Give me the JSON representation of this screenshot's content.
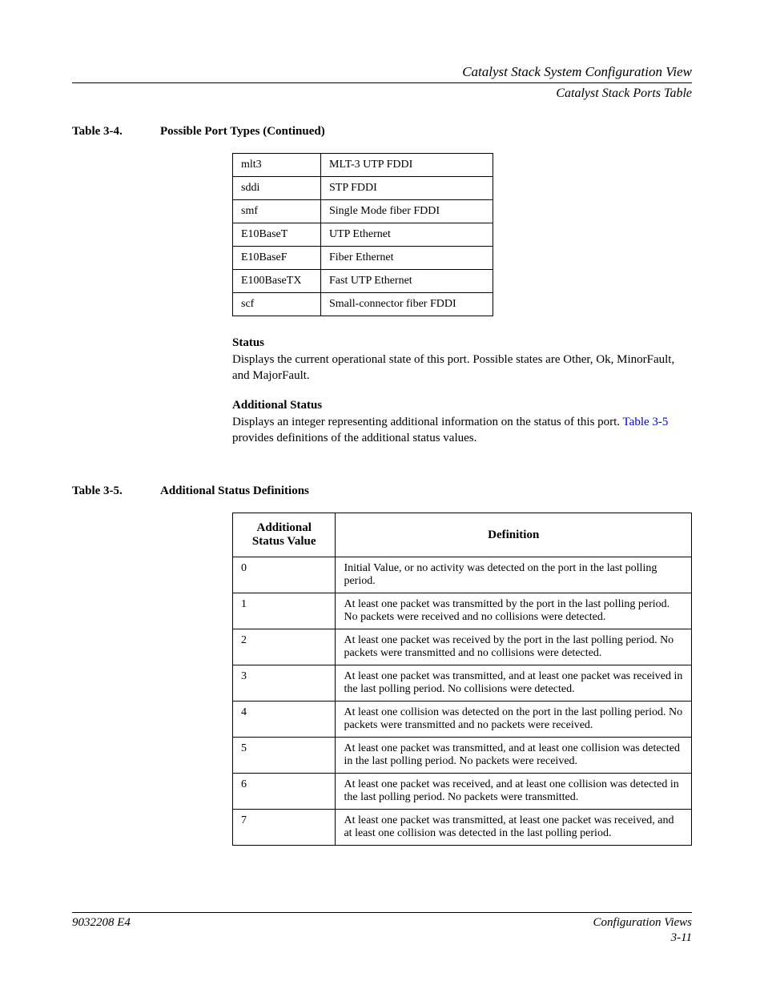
{
  "header": {
    "title": "Catalyst Stack System Configuration View",
    "subtitle": "Catalyst Stack Ports Table"
  },
  "table34": {
    "number": "Table 3-4.",
    "title": "Possible Port Types (Continued)",
    "rows": [
      {
        "c1": "mlt3",
        "c2": "MLT-3 UTP FDDI"
      },
      {
        "c1": "sddi",
        "c2": "STP FDDI"
      },
      {
        "c1": "smf",
        "c2": "Single Mode fiber FDDI"
      },
      {
        "c1": "E10BaseT",
        "c2": "UTP Ethernet"
      },
      {
        "c1": "E10BaseF",
        "c2": "Fiber Ethernet"
      },
      {
        "c1": "E100BaseTX",
        "c2": "Fast UTP Ethernet"
      },
      {
        "c1": "scf",
        "c2": "Small-connector fiber FDDI"
      }
    ]
  },
  "status_field": {
    "title": "Status",
    "desc": "Displays the current operational state of this port. Possible states are Other, Ok, MinorFault, and MajorFault."
  },
  "additional_status_field": {
    "title": "Additional Status",
    "desc_pre": "Displays an integer representing additional information on the status of this port. ",
    "link": "Table 3-5",
    "desc_post": " provides definitions of the additional status values."
  },
  "table35": {
    "number": "Table 3-5.",
    "title": "Additional Status Definitions",
    "headers": {
      "col1_line1": "Additional",
      "col1_line2": "Status Value",
      "col2": "Definition"
    },
    "rows": [
      {
        "val": "0",
        "def": "Initial Value, or no activity was detected on the port in the last polling period."
      },
      {
        "val": "1",
        "def": "At least one packet was transmitted by the port in the last polling period. No packets were received and no collisions were detected."
      },
      {
        "val": "2",
        "def": "At least one packet was received by the port in the last polling period. No packets were transmitted and no collisions were detected."
      },
      {
        "val": "3",
        "def": "At least one packet was transmitted, and at least one packet was received in the last polling period. No collisions were detected."
      },
      {
        "val": "4",
        "def": "At least one collision was detected on the port in the last polling period. No packets were transmitted and no packets were received."
      },
      {
        "val": "5",
        "def": "At least one packet was transmitted, and at least one collision was detected in the last polling period. No packets were received."
      },
      {
        "val": "6",
        "def": "At least one packet was received, and at least one collision was detected in the last polling period. No packets were transmitted."
      },
      {
        "val": "7",
        "def": "At least one packet was transmitted, at least one packet was received, and at least one collision was detected in the last polling period."
      }
    ]
  },
  "footer": {
    "left": "9032208 E4",
    "right": "Configuration Views",
    "page": "3-11"
  }
}
